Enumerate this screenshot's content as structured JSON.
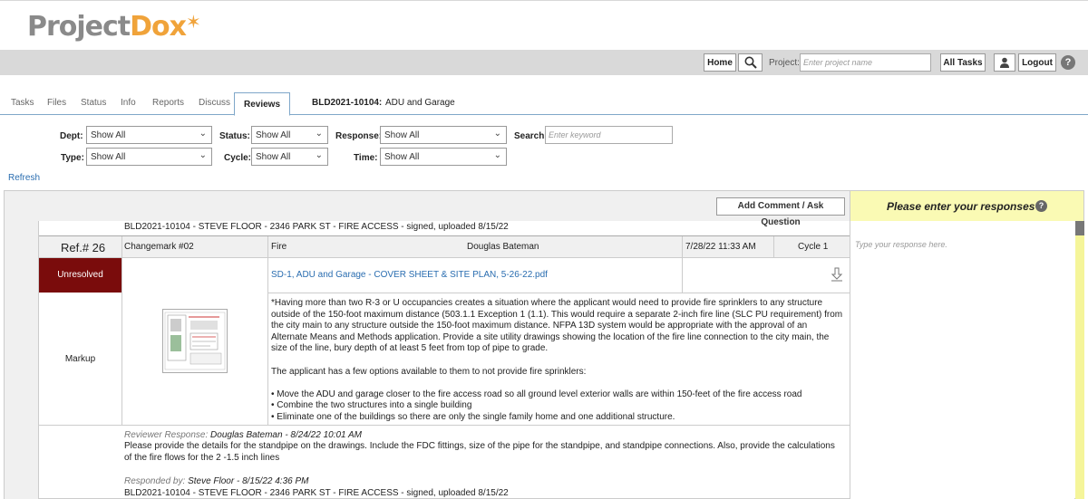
{
  "app": {
    "logo_part1": "Project",
    "logo_part2": "Dox"
  },
  "toolbar": {
    "home": "Home",
    "project_label": "Project:",
    "project_placeholder": "Enter project name",
    "all_tasks": "All Tasks",
    "logout": "Logout"
  },
  "tabs": [
    "Tasks",
    "Files",
    "Status",
    "Info",
    "Reports",
    "Discuss",
    "Reviews"
  ],
  "project": {
    "code": "BLD2021-10104:",
    "name": "ADU and Garage"
  },
  "filters": {
    "dept_label": "Dept:",
    "dept_value": "Show All",
    "status_label": "Status:",
    "status_value": "Show All",
    "response_label": "Response:",
    "response_value": "Show All",
    "search_label": "Search:",
    "search_placeholder": "Enter keyword",
    "type_label": "Type:",
    "type_value": "Show All",
    "cycle_label": "Cycle:",
    "cycle_value": "Show All",
    "time_label": "Time:",
    "time_value": "Show All"
  },
  "refresh": "Refresh",
  "panel": {
    "add_comment": "Add Comment / Ask Question",
    "responses_title": "Please enter your responses",
    "response_placeholder": "Type your response here.",
    "previous_line": "BLD2021-10104 - STEVE FLOOR - 2346 PARK ST - FIRE ACCESS - signed, uploaded 8/15/22"
  },
  "comment": {
    "ref": "Ref.# 26",
    "changemark": "Changemark #02",
    "dept": "Fire",
    "reviewer": "Douglas Bateman",
    "date": "7/28/22 11:33 AM",
    "cycle": "Cycle 1",
    "status": "Unresolved",
    "type": "Markup",
    "file": "SD-1, ADU and Garage - COVER SHEET & SITE PLAN, 5-26-22.pdf",
    "para1": "*Having more than two R-3 or U occupancies creates a situation where the applicant would need to provide fire sprinklers to any structure outside of the 150-foot maximum distance (503.1.1 Exception 1 (1.1). This would require a separate 2-inch fire line (SLC PU requirement) from the city main to any structure outside the 150-foot maximum distance. NFPA 13D system would be appropriate with the approval of an Alternate Means and Methods application. Provide a site utility drawings showing the location of the fire line connection to the city main, the size of the line, bury depth of at least 5 feet from top of pipe to grade.",
    "para2": "The applicant has a few options available to them to not provide fire sprinklers:",
    "bullet1": "• Move the ADU and garage closer to the fire access road so all ground level exterior walls are within 150-feet of the fire access road",
    "bullet2": "• Combine the two structures into a single building",
    "bullet3": "• Eliminate one of the buildings so there are only the single family home and one additional structure."
  },
  "reviewer_response": {
    "label": "Reviewer Response:",
    "meta": "Douglas Bateman - 8/24/22 10:01 AM",
    "text": "Please provide the details for the standpipe on the drawings. Include the FDC fittings, size of the pipe for the standpipe, and standpipe connections. Also, provide the calculations of the fire flows for the 2 -1.5 inch lines"
  },
  "responded_by": {
    "label": "Responded by:",
    "meta": "Steve Floor - 8/15/22 4:36 PM",
    "text": "BLD2021-10104 - STEVE FLOOR - 2346 PARK ST - FIRE ACCESS - signed, uploaded 8/15/22"
  },
  "colors": {
    "unresolved": "#7a0c0c",
    "link": "#2a6db0",
    "response_panel": "#fafab4",
    "accent": "#f0a33a"
  }
}
